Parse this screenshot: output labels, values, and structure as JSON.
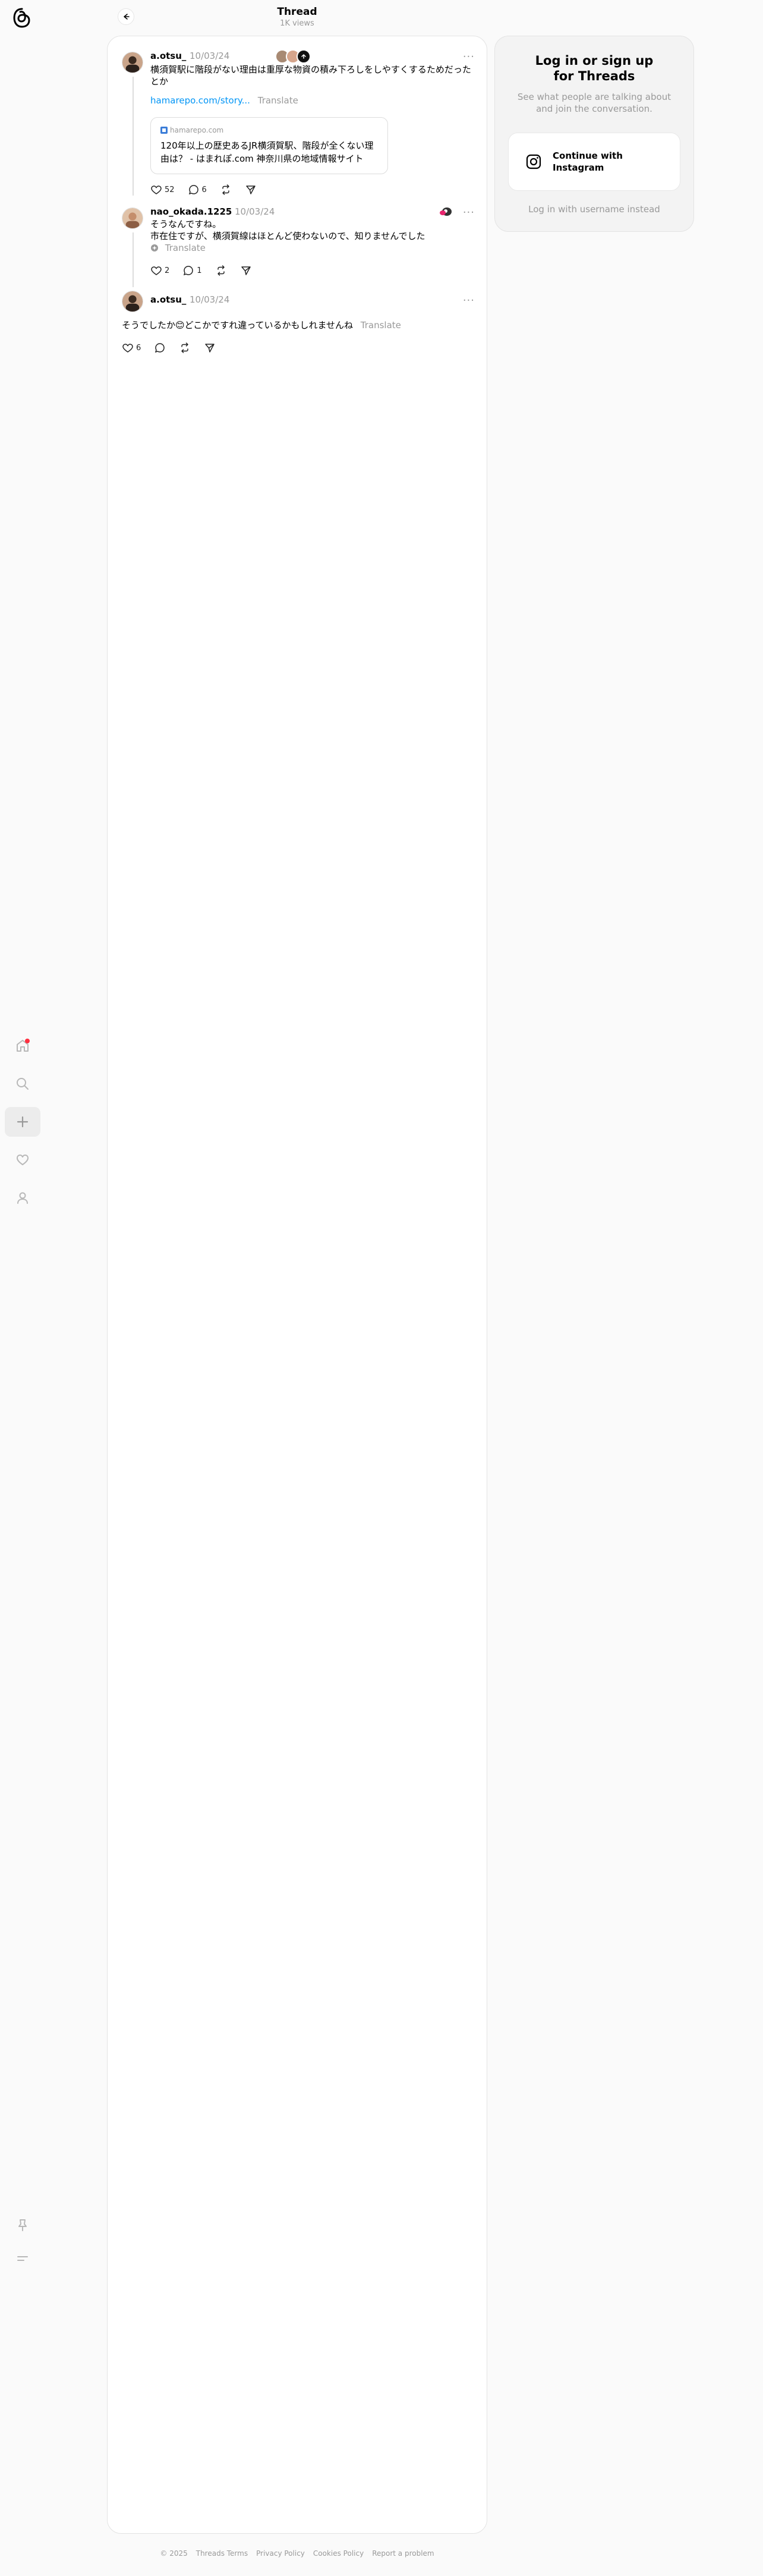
{
  "header": {
    "title": "Thread",
    "views": "1K views"
  },
  "sidebar": {
    "items": [
      {
        "name": "home",
        "icon": "home-icon"
      },
      {
        "name": "search",
        "icon": "search-icon"
      },
      {
        "name": "create",
        "icon": "plus-icon"
      },
      {
        "name": "activity",
        "icon": "heart-icon"
      },
      {
        "name": "profile",
        "icon": "user-icon"
      },
      {
        "name": "pin",
        "icon": "pin-icon"
      },
      {
        "name": "menu",
        "icon": "menu-icon"
      }
    ]
  },
  "posts": [
    {
      "username": "a.otsu_",
      "date": "10/03/24",
      "text": "横須賀駅に階段がない理由は重厚な物資の積み下ろしをしやすくするためだったとか",
      "link": "hamarepo.com/story...",
      "translate": "Translate",
      "card": {
        "domain": "hamarepo.com",
        "title": "120年以上の歴史あるJR横須賀駅、階段が全くない理由は？ - はまれぽ.com 神奈川県の地域情報サイト"
      },
      "likes": "52",
      "replies": "6"
    },
    {
      "username": "nao_okada.1225",
      "date": "10/03/24",
      "text_line1": "そうなんですね。",
      "text_line2": "市在住ですが、横須賀線はほとんど使わないので、知りませんでした",
      "translate": "Translate",
      "likes": "2",
      "replies": "1"
    },
    {
      "username": "a.otsu_",
      "date": "10/03/24",
      "text": "そうでしたか😊どこかですれ違っているかもしれませんね",
      "translate": "Translate",
      "likes": "6"
    }
  ],
  "login": {
    "title": "Log in or sign up for Threads",
    "subtitle": "See what people are talking about and join the conversation.",
    "instagram_button": "Continue with Instagram",
    "alt": "Log in with username instead"
  },
  "footer": {
    "copyright": "© 2025",
    "terms": "Threads Terms",
    "privacy": "Privacy Policy",
    "cookies": "Cookies Policy",
    "report": "Report a problem"
  },
  "colors": {
    "accent": "#0095f6",
    "notification": "#ff3040",
    "muted": "#999999"
  }
}
